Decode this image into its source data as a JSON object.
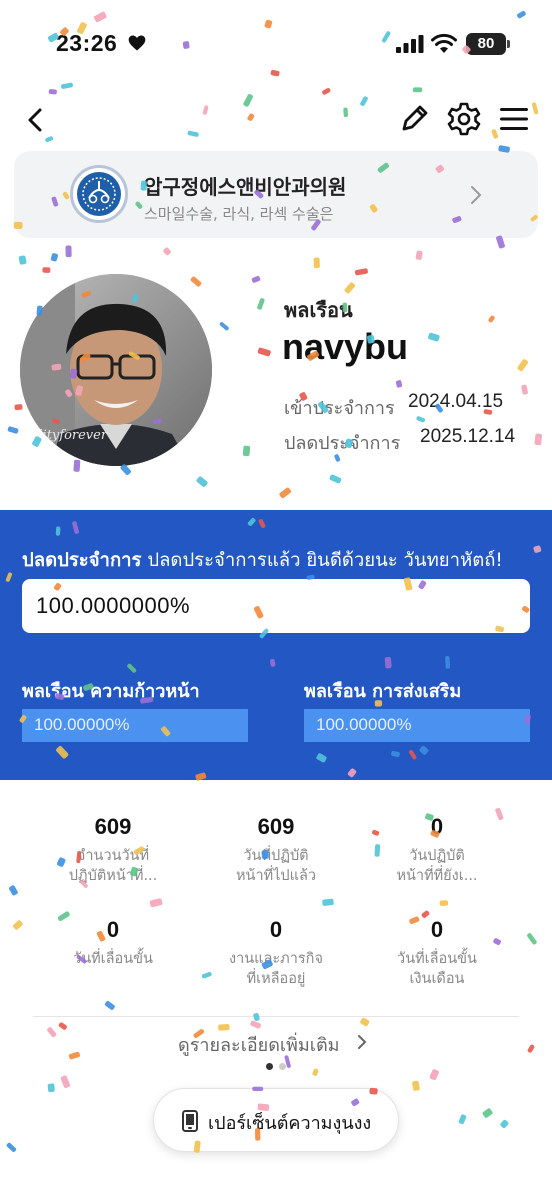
{
  "status_bar": {
    "time": "23:26",
    "battery": "80"
  },
  "nav": {
    "back_icon": "chevron-left-icon",
    "edit_icon": "pencil-icon",
    "settings_icon": "gear-icon",
    "menu_icon": "hamburger-menu-icon"
  },
  "ad": {
    "title": "압구정에스앤비안과의원",
    "subtitle": "스마일수술, 라식, 라섹 수술은"
  },
  "profile": {
    "rank": "พลเรือน",
    "username": "navybu",
    "enlist_label": "เข้าประจำการ",
    "enlist_date": "2024.04.15",
    "discharge_label": "ปลดประจำการ",
    "discharge_date": "2025.12.14",
    "avatar_watermark": "ulityforever"
  },
  "progress": {
    "heading_bold": "ปลดประจำการ",
    "heading_message": " ปลดประจำการแล้ว ยินดีด้วยนะ วันทยาหัตถ์!",
    "main_value": "100.0000000%",
    "main_fraction": 1.0,
    "left_label": "พลเรือน ความก้าวหน้า",
    "left_value": "100.00000%",
    "left_fraction": 1.0,
    "right_label": "พลเรือน การส่งเสริม",
    "right_value": "100.00000%",
    "right_fraction": 1.0
  },
  "stats": [
    {
      "value": "609",
      "label_line1": "จำนวนวันที่",
      "label_line2": "ปฏิบัติหน้าที่..."
    },
    {
      "value": "609",
      "label_line1": "วันที่ปฏิบัติ",
      "label_line2": "หน้าที่ไปแล้ว"
    },
    {
      "value": "0",
      "label_line1": "วันปฏิบัติ",
      "label_line2": "หน้าที่ที่ยังเ..."
    },
    {
      "value": "0",
      "label_line1": "วันที่เลื่อนขั้น",
      "label_line2": ""
    },
    {
      "value": "0",
      "label_line1": "งานและภารกิจ",
      "label_line2": "ที่เหลืออยู่"
    },
    {
      "value": "0",
      "label_line1": "วันที่เลื่อนขั้น",
      "label_line2": "เงินเดือน"
    }
  ],
  "more_link": "ดูรายละเอียดเพิ่มเติม",
  "percent_button": "เปอร์เซ็นต์ความงุนงง",
  "colors": {
    "primary_blue": "#2358c4",
    "bar_fill": "#4b92f0",
    "bar_track": "#e5ebf7"
  }
}
